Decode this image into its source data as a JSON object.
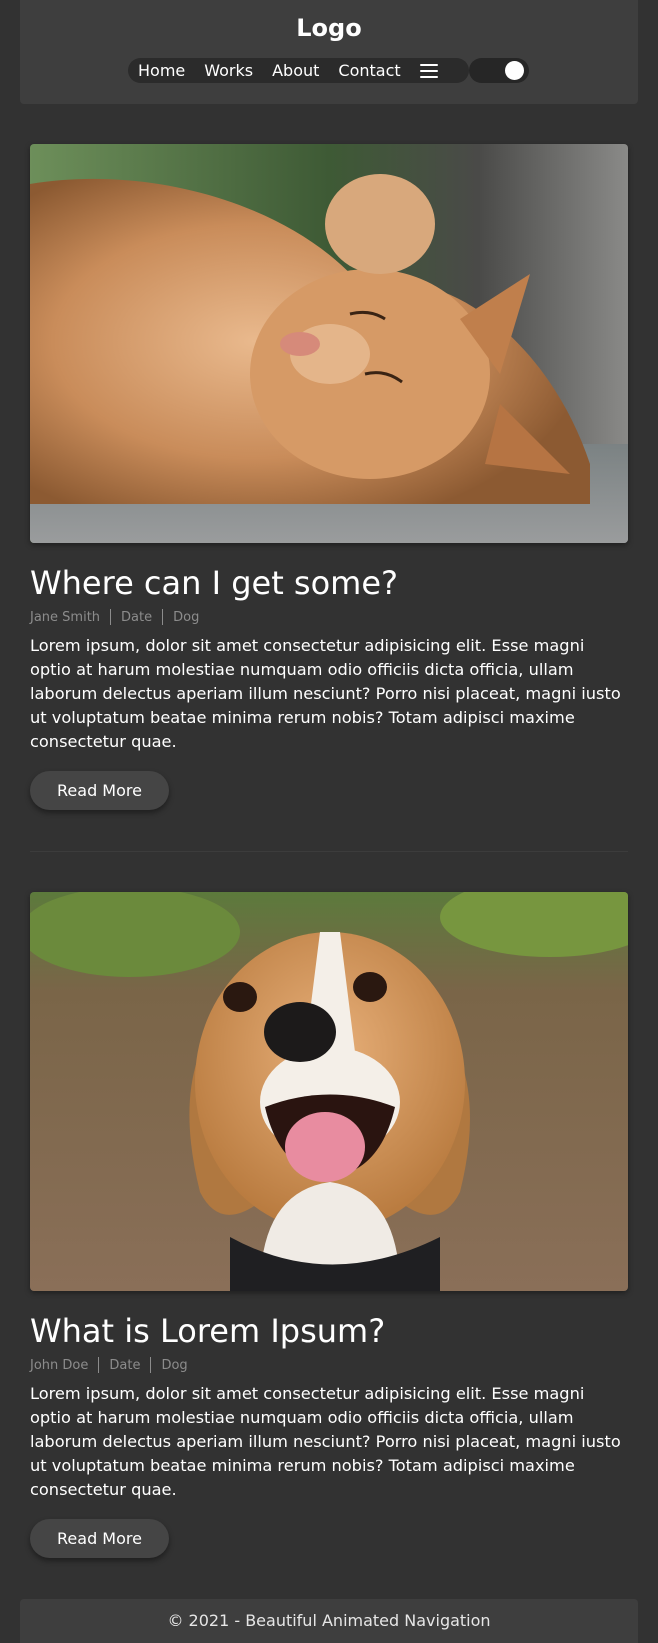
{
  "header": {
    "logo": "Logo",
    "nav": [
      "Home",
      "Works",
      "About",
      "Contact"
    ],
    "theme_toggle": "on"
  },
  "posts": [
    {
      "image": "sleeping orange tabby cat",
      "title": "Where can I get some?",
      "meta": {
        "author": "Jane Smith",
        "date": "Date",
        "category": "Dog"
      },
      "body": "Lorem ipsum, dolor sit amet consectetur adipisicing elit. Esse magni optio at harum molestiae numquam odio officiis dicta officia, ullam laborum delectus aperiam illum nesciunt? Porro nisi placeat, magni iusto ut voluptatum beatae minima rerum nobis? Totam adipisci maxime consectetur quae.",
      "button": "Read More"
    },
    {
      "image": "smiling beagle dog",
      "title": "What is Lorem Ipsum?",
      "meta": {
        "author": "John Doe",
        "date": "Date",
        "category": "Dog"
      },
      "body": "Lorem ipsum, dolor sit amet consectetur adipisicing elit. Esse magni optio at harum molestiae numquam odio officiis dicta officia, ullam laborum delectus aperiam illum nesciunt? Porro nisi placeat, magni iusto ut voluptatum beatae minima rerum nobis? Totam adipisci maxime consectetur quae.",
      "button": "Read More"
    }
  ],
  "footer": {
    "text": "© 2021 - Beautiful Animated Navigation"
  }
}
